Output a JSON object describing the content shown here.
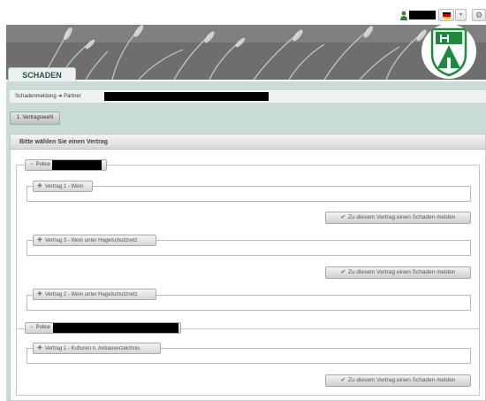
{
  "header": {
    "tab_label": "SCHADEN",
    "lang_dropdown_icon": "chevron-down-icon",
    "settings_icon": "gear-icon",
    "flag_colors": [
      "#000000",
      "#dd0000",
      "#ffce00"
    ]
  },
  "breadcrumb": {
    "text": "Schadenmeldung ➜ Partner"
  },
  "steps": {
    "step1_label": "1. Vertragswahl"
  },
  "panel": {
    "title": "Bitte wählen Sie einen Vertrag"
  },
  "policies": [
    {
      "label": "Police",
      "contracts": [
        {
          "label": "Vertrag 1 - Wein"
        },
        {
          "label": "Vertrag 3 - Wein unter Hagelschutznetz"
        },
        {
          "label": "Vertrag 2 - Wein unter Hagelschutznetz"
        }
      ]
    },
    {
      "label": "Police",
      "contracts": [
        {
          "label": "Vertrag 1 - Kulturen n. Anbauverzeichnis"
        }
      ]
    }
  ],
  "actions": {
    "report_label": "Zu diesem Vertrag einen Schaden melden"
  },
  "symbols": {
    "collapse": "−",
    "expand": "✚",
    "check": "✔"
  },
  "colors": {
    "band": "#c9dcd6",
    "tab_text": "#2d4f4f"
  }
}
